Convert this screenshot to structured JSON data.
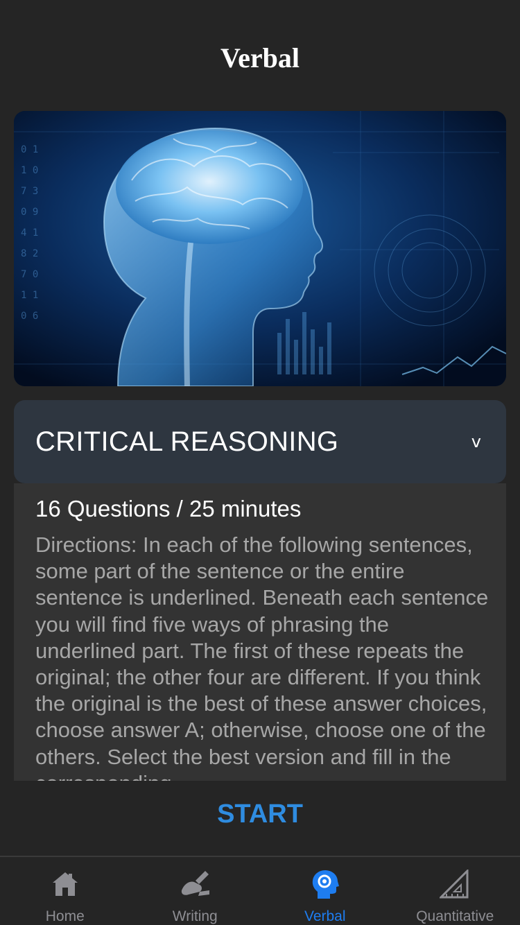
{
  "header": {
    "title": "Verbal"
  },
  "section": {
    "title": "CRITICAL REASONING",
    "chevron": "v"
  },
  "details": {
    "meta": "16 Questions / 25 minutes",
    "directions": "Directions: In each of the following sentences, some part of the sentence or the entire sentence is underlined. Beneath each sentence you will find five ways of phrasing the underlined part. The first of these repeats the original; the other four are different. If you think the original is the best of these answer choices, choose answer A; otherwise, choose one of the others. Select the best version and fill in the corresponding"
  },
  "start_label": "START",
  "tabs": [
    {
      "label": "Home",
      "icon": "home-icon",
      "active": false
    },
    {
      "label": "Writing",
      "icon": "writing-icon",
      "active": false
    },
    {
      "label": "Verbal",
      "icon": "brain-head-icon",
      "active": true
    },
    {
      "label": "Quantitative",
      "icon": "ruler-triangle-icon",
      "active": false
    }
  ],
  "colors": {
    "background": "#252525",
    "accent": "#2f8ce0",
    "tab_active": "#1e7df0",
    "tab_inactive": "#8e8e93"
  }
}
